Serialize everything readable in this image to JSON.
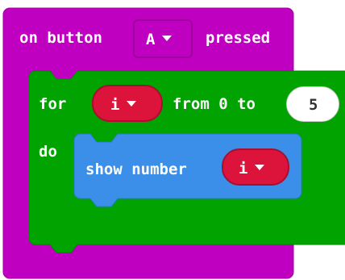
{
  "event_block": {
    "label_prefix": "on button",
    "button_option": "A",
    "label_suffix": "pressed",
    "color": "#c000c0"
  },
  "for_block": {
    "label_for": "for",
    "variable": "i",
    "label_from": "from 0 to",
    "end_value": "5",
    "label_do": "do",
    "color": "#00a300"
  },
  "show_block": {
    "label": "show number",
    "variable": "i",
    "color": "#3b8fe8"
  },
  "colors": {
    "variable_pill": "#dc143c"
  }
}
